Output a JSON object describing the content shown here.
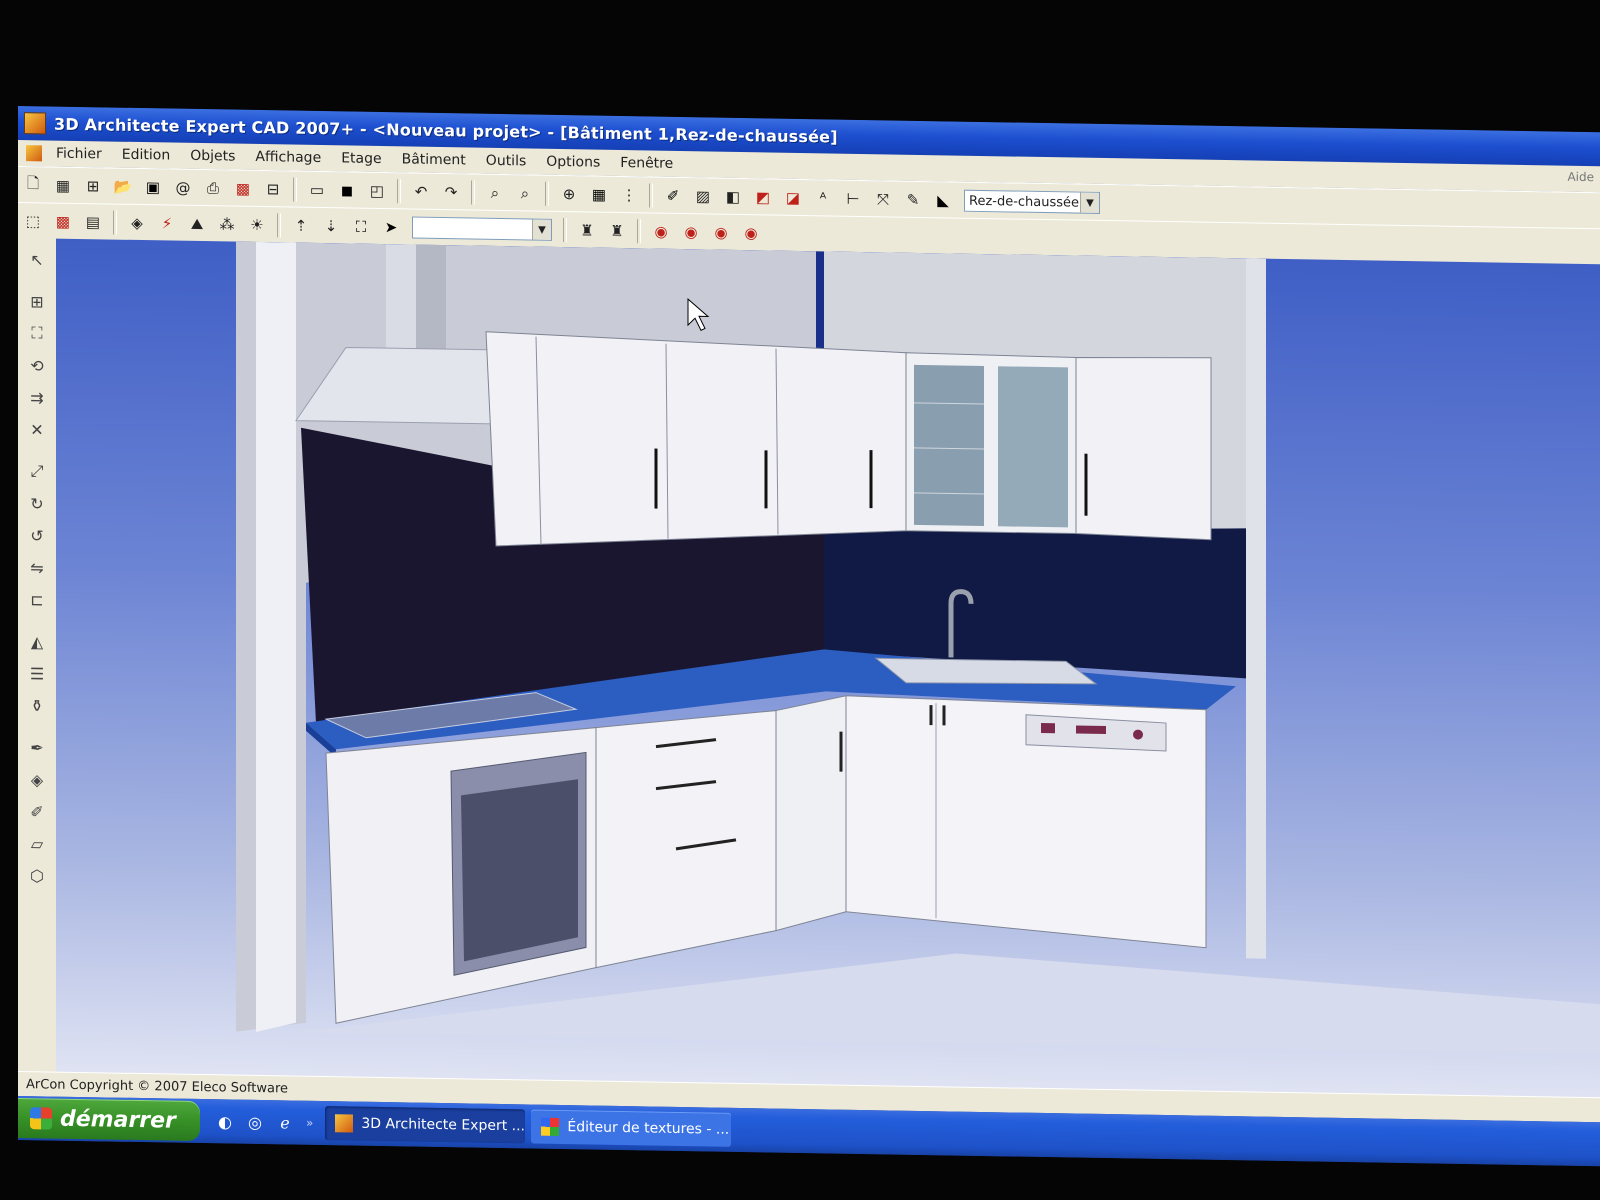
{
  "window": {
    "title": "3D Architecte Expert CAD 2007+   - <Nouveau projet> - [Bâtiment 1,Rez-de-chaussée]"
  },
  "menu": {
    "items": [
      "Fichier",
      "Edition",
      "Objets",
      "Affichage",
      "Etage",
      "Bâtiment",
      "Outils",
      "Options",
      "Fenêtre"
    ],
    "help": "Aide"
  },
  "toolbar": {
    "floor_select": "Rez-de-chaussée",
    "second_select": ""
  },
  "statusbar": {
    "text": "ArCon Copyright © 2007 Eleco Software"
  },
  "taskbar": {
    "start_label": "démarrer",
    "tasks": [
      "3D Architecte Expert ...",
      "Éditeur de textures - ..."
    ]
  },
  "icons": {
    "toolbar1": [
      "new-document-icon",
      "plan-view-icon",
      "section-view-icon",
      "open-folder-icon",
      "save-icon",
      "email-icon",
      "print-icon",
      "render-icon",
      "layout-icon",
      "window-icon",
      "3d-box-icon",
      "frame-icon",
      "undo-icon",
      "redo-icon",
      "zoom-icon",
      "zoom-text-icon",
      "crosshair-icon",
      "grid-icon",
      "ruler-icon",
      "brush-icon",
      "hatch-icon",
      "door-icon",
      "window-red-icon",
      "stair-icon",
      "text-abc-icon",
      "dimension-icon",
      "measure-icon",
      "pencil-icon",
      "camera-icon"
    ],
    "toolbar2": [
      "select-3d-icon",
      "texture-icon",
      "object-icon",
      "cube-icon",
      "lightning-icon",
      "terrain-icon",
      "molecule-icon",
      "sun-icon",
      "floor-up-icon",
      "floor-down-icon",
      "fit-view-icon",
      "play-icon",
      "walk-red-icon",
      "walk-green-icon",
      "eye-up-icon",
      "eye-down-icon",
      "eye-left-icon",
      "eye-right-icon"
    ],
    "left": [
      "select-arrow-icon",
      "group-icon",
      "resize-icon",
      "rotate-box-icon",
      "move-icon",
      "delete-icon",
      "scale-icon",
      "rotate-90-icon",
      "rotate-180-icon",
      "flip-icon",
      "align-icon",
      "mirror-icon",
      "list-icon",
      "paint-bucket-icon",
      "pen-icon",
      "fill-icon",
      "paint-roller-icon",
      "eraser-icon",
      "cube-small-icon"
    ]
  },
  "colors": {
    "titlebar": "#1d4fd0",
    "chrome": "#ece9d8",
    "viewport_top": "#3f5fc6",
    "countertop": "#2c5dc0",
    "cabinet": "#f2f2f6"
  }
}
